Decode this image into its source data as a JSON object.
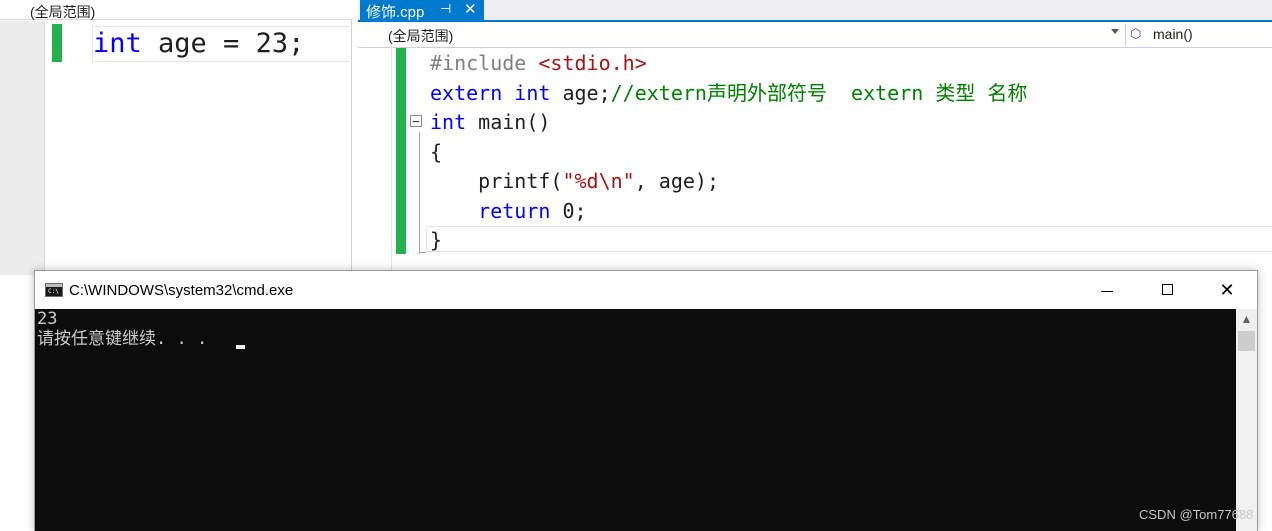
{
  "left_pane": {
    "scope": "(全局范围)",
    "code": {
      "keyword": "int",
      "rest": " age = 23;"
    }
  },
  "editor": {
    "tab": {
      "title": "修饰.cpp",
      "pin_icon": "⊣",
      "close_icon": "✕"
    },
    "scope": "(全局范围)",
    "member": "main()",
    "lines": {
      "l1_include": "#include",
      "l1_header": " <stdio.h>",
      "l2_extern": "extern",
      "l2_int": "int",
      "l2_decl": " age;",
      "l2_comment": "//extern声明外部符号  extern 类型 名称",
      "l3_int": "int",
      "l3_main": " main()",
      "l4_brace": "{",
      "l5_printf": "    printf(",
      "l5_fmt": "\"%d\\n\"",
      "l5_rest": ", age);",
      "l6_indent": "    ",
      "l6_return": "return",
      "l6_rest": " 0;",
      "l7_brace": "}"
    }
  },
  "cmd": {
    "title": "C:\\WINDOWS\\system32\\cmd.exe",
    "icon_text": "C:\\",
    "output": [
      "23",
      "请按任意键继续. . . "
    ]
  },
  "watermark": "CSDN @Tom77688",
  "colors": {
    "keyword": "#0000ff",
    "preprocessor": "#808080",
    "string": "#a31515",
    "comment": "#008000",
    "change_bar": "#22b14c",
    "tab_active": "#007acc",
    "console_bg": "#0c0c0c"
  }
}
